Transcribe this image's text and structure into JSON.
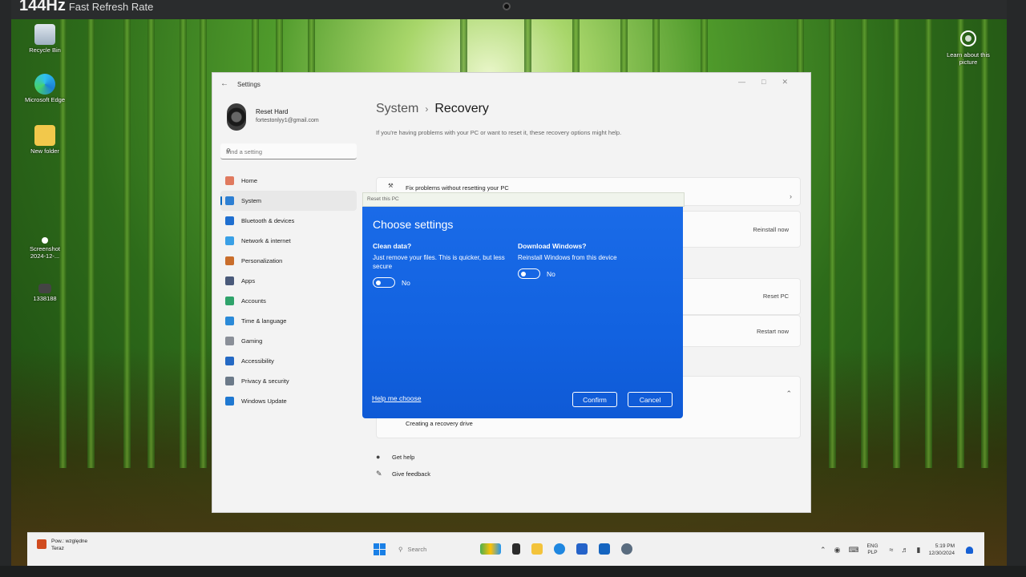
{
  "overlay": {
    "badge_main": "144Hz",
    "badge_sub": "Fast Refresh Rate"
  },
  "desktop": {
    "icons": [
      {
        "label": "Recycle Bin"
      },
      {
        "label": "Microsoft Edge"
      },
      {
        "label": "New folder"
      },
      {
        "label": "Screenshot 2024-12-..."
      },
      {
        "label": "1338188"
      }
    ],
    "learn_label": "Learn about this picture"
  },
  "window": {
    "title": "Settings",
    "profile": {
      "name": "Reset Hard",
      "email": "fortestonlyy1@gmail.com"
    },
    "search_placeholder": "Find a setting",
    "nav": [
      {
        "label": "Home",
        "icon": "home-icon",
        "color": "#e07a5f"
      },
      {
        "label": "System",
        "icon": "system-icon",
        "color": "#2d7fd3",
        "active": true
      },
      {
        "label": "Bluetooth & devices",
        "icon": "bluetooth-icon",
        "color": "#1f6fd0"
      },
      {
        "label": "Network & internet",
        "icon": "network-icon",
        "color": "#3aa0e6"
      },
      {
        "label": "Personalization",
        "icon": "brush-icon",
        "color": "#c96e2c"
      },
      {
        "label": "Apps",
        "icon": "apps-icon",
        "color": "#4a5a7a"
      },
      {
        "label": "Accounts",
        "icon": "accounts-icon",
        "color": "#2fa36b"
      },
      {
        "label": "Time & language",
        "icon": "clock-globe-icon",
        "color": "#2b8ad8"
      },
      {
        "label": "Gaming",
        "icon": "gaming-icon",
        "color": "#8a8f98"
      },
      {
        "label": "Accessibility",
        "icon": "accessibility-icon",
        "color": "#2469c4"
      },
      {
        "label": "Privacy & security",
        "icon": "shield-icon",
        "color": "#6c7a89"
      },
      {
        "label": "Windows Update",
        "icon": "update-icon",
        "color": "#1f78d1"
      }
    ],
    "breadcrumb": {
      "parent": "System",
      "current": "Recovery"
    },
    "lead": "If you're having problems with your PC or want to reset it, these recovery options might help.",
    "fix_label": "Fix problems without resetting your PC",
    "reinstall_label": "Reinstall now",
    "reset_label": "Reset PC",
    "restart_label": "Restart now",
    "recovery_drive_label": "Creating a recovery drive",
    "get_help": "Get help",
    "give_feedback": "Give feedback"
  },
  "dialog": {
    "frame_title": "Reset this PC",
    "title": "Choose settings",
    "clean": {
      "heading": "Clean data?",
      "desc": "Just remove your files. This is quicker, but less secure",
      "value": "No"
    },
    "download": {
      "heading": "Download Windows?",
      "desc": "Reinstall Windows from this device",
      "value": "No"
    },
    "help_link": "Help me choose",
    "confirm": "Confirm",
    "cancel": "Cancel"
  },
  "taskbar": {
    "notification": {
      "line1": "Pow.: względne",
      "line2": "Teraz"
    },
    "search_placeholder": "Search",
    "lang": {
      "top": "ENG",
      "bottom": "PLP"
    },
    "clock": {
      "time": "5:19 PM",
      "date": "12/30/2024"
    }
  }
}
